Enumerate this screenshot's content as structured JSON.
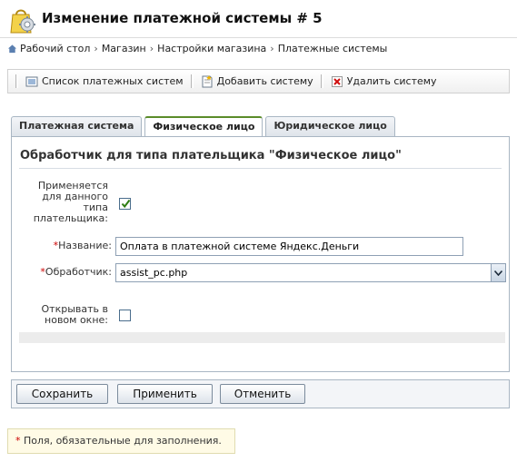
{
  "header": {
    "title": "Изменение платежной системы # 5"
  },
  "breadcrumb": [
    "Рабочий стол",
    "Магазин",
    "Настройки магазина",
    "Платежные системы"
  ],
  "toolbar": {
    "list_label": "Список платежных систем",
    "add_label": "Добавить систему",
    "delete_label": "Удалить систему"
  },
  "tabs": [
    {
      "label": "Платежная система",
      "active": false
    },
    {
      "label": "Физическое лицо",
      "active": true
    },
    {
      "label": "Юридическое лицо",
      "active": false
    }
  ],
  "panel": {
    "heading": "Обработчик для типа плательщика \"Физическое лицо\"",
    "applies_label_lines": [
      "Применяется",
      "для данного",
      "типа",
      "плательщика:"
    ],
    "applies_checked": true,
    "name_label": "Название:",
    "name_value": "Оплата в платежной системе Яндекс.Деньги",
    "handler_label": "Обработчик:",
    "handler_value": "assist_pc.php",
    "new_window_label_lines": [
      "Открывать в",
      "новом окне:"
    ],
    "new_window_checked": false,
    "required_mark": "*"
  },
  "buttons": {
    "save": "Сохранить",
    "apply": "Применить",
    "cancel": "Отменить"
  },
  "note": {
    "mark": "*",
    "text": " Поля, обязательные для заполнения."
  },
  "colors": {
    "required": "#cc0000",
    "active_tab_accent": "#5b8c2a",
    "check": "#2f7d12"
  }
}
